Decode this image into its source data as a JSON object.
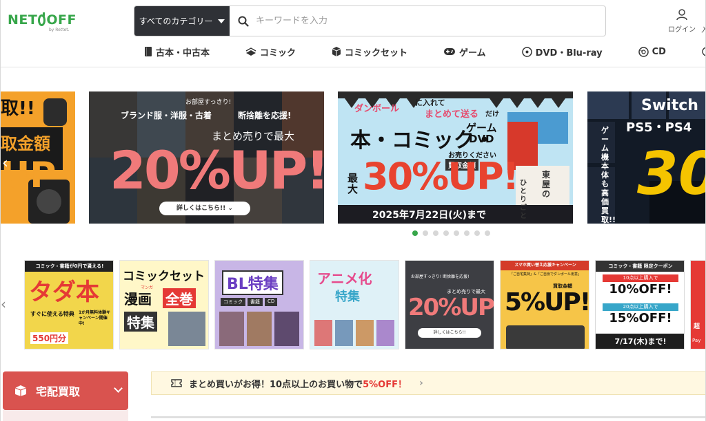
{
  "header": {
    "logo": "NET OFF",
    "logo_sub": "by Rettet.",
    "category_select": "すべてのカテゴリー",
    "search_placeholder": "キーワードを入力",
    "login_label": "ログイン",
    "cut_label": "入"
  },
  "nav": [
    {
      "label": "古本・中古本",
      "icon": "book-icon"
    },
    {
      "label": "コミック",
      "icon": "comic-icon"
    },
    {
      "label": "コミックセット",
      "icon": "box-icon"
    },
    {
      "label": "ゲーム",
      "icon": "gamepad-icon"
    },
    {
      "label": "DVD・Blu-ray",
      "icon": "disc-icon"
    },
    {
      "label": "CD",
      "icon": "cd-icon"
    }
  ],
  "banners": {
    "b0": {
      "line1": "取!!",
      "line2": "取金額",
      "line3": "UP"
    },
    "b1": {
      "tag": "お部屋すっきり!",
      "line1": "ブランド服・洋服・古着",
      "line2": "断捨離を応援!",
      "line3": "まとめ売りで最大",
      "big": "20%UP!",
      "button": "詳しくはこちら!!"
    },
    "b2": {
      "line1": "ダンボール",
      "line1b": "に入れて",
      "line2": "まとめて送る",
      "line2b": "だけ",
      "title": "本・コミック・",
      "title2": "ゲーム",
      "title3": "DVD",
      "sub": "お売りください",
      "sub2": "買取金額",
      "max": "最大",
      "big": "30%UP!",
      "date": "2025年7月22日(火)まで",
      "book_title": "東屋の",
      "book_title2": "ひとりごと"
    },
    "b3": {
      "line1": "Switch",
      "line2": "PS5・PS4",
      "side": "ゲーム機本体も高価買取!!",
      "big": "30"
    }
  },
  "thumbs": [
    {
      "top": "コミック・書籍が0円で貰える!",
      "big": "タダ本",
      "sub": "すぐに使える特典",
      "badge": "1か月無料体験キャンペーン開催中!",
      "price": "550円分"
    },
    {
      "line1": "コミックセット",
      "line2": "漫画",
      "line3": "全巻",
      "line4": "特集",
      "ruby": "マンガ"
    },
    {
      "line1": "BL特集",
      "tags": [
        "コミック",
        "書籍",
        "CD"
      ]
    },
    {
      "line1": "アニメ化",
      "line2": "特集"
    },
    {
      "line1": "お部屋すっきり! 断捨離を応援!",
      "line2": "まとめ売りで最大",
      "big": "20%UP!",
      "button": "詳しくはこちら!!"
    },
    {
      "line1": "スマホ買い替え応援キャンペーン",
      "line2": "「ご自宅集荷」&「ご自身でダンボール用意」",
      "line3": "買取金額",
      "big": "5%UP!!"
    },
    {
      "line1": "コミック・書籍 限定クーポン",
      "line2": "10点以上購入で",
      "big1": "10%OFF!",
      "line3": "20点以上購入で",
      "big2": "15%OFF!",
      "date": "7/17(木)まで!"
    },
    {
      "line1": "超",
      "line2": "Pay"
    }
  ],
  "sidebar": {
    "takuhai": "宅配買取"
  },
  "promo": {
    "text": "まとめ買いがお得！10点以上のお買い物で",
    "red": "5%OFF！"
  },
  "carousel": {
    "dot_count": 8,
    "active_dot": 0
  },
  "colors": {
    "brand_green": "#37a64a",
    "accent_red": "#d9534f",
    "promo_red": "#e53935",
    "dark": "#2f3136"
  }
}
